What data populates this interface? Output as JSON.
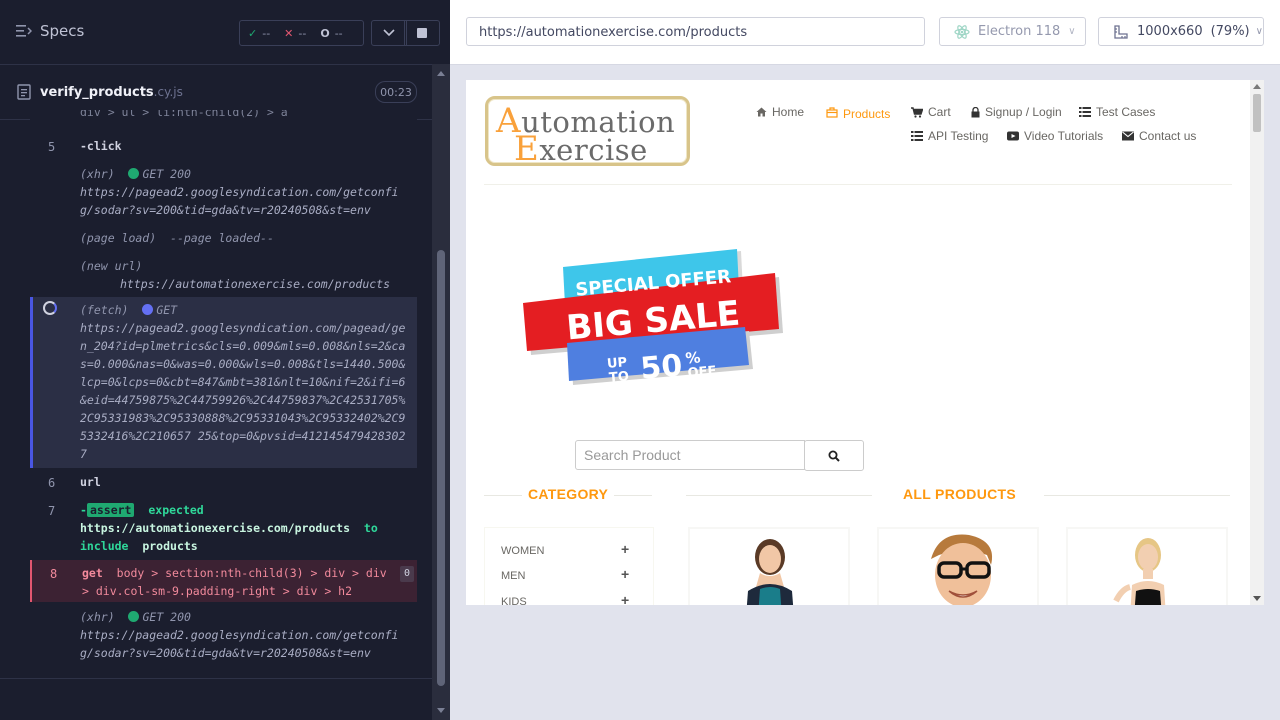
{
  "runner": {
    "specs_label": "Specs",
    "stats": {
      "passed": "--",
      "failed": "--",
      "pending": "--"
    },
    "spec_file": {
      "name": "verify_products",
      "ext": ".cy.js",
      "duration": "00:23"
    },
    "commands": [
      {
        "num": "",
        "name": "",
        "text": "div > ul > li:nth-child(2) > a"
      },
      {
        "num": "5",
        "name": "-click"
      },
      {
        "kind": "(xhr)",
        "method": "GET 200",
        "url": "https://pagead2.googlesyndication.com/getconfig/sodar?sv=200&tid=gda&tv=r20240508&st=env"
      },
      {
        "kind": "(page load)",
        "message": "--page loaded--"
      },
      {
        "kind": "(new url)",
        "url": "https://automationexercise.com/products"
      },
      {
        "kind": "(fetch)",
        "method": "GET",
        "url": "https://pagead2.googlesyndication.com/pagead/gen_204?id=plmetrics&cls=0.009&mls=0.008&nls=2&cas=0.000&nas=0&was=0.000&wls=0.008&tls=1440.500&lcp=0&lcps=0&cbt=847&mbt=381&nlt=10&nif=2&ifi=6&eid=44759875%2C44759926%2C44759837%2C42531705%2C95331983%2C95330888%2C95331043%2C95332402%2C95332416%2C210657 25&top=0&pvsid=4121454794283027"
      },
      {
        "num": "6",
        "name": "url"
      },
      {
        "num": "7",
        "name": "-assert",
        "expected": "expected",
        "value": "https://automationexercise.com/products",
        "to": "to",
        "include": "include",
        "target": "products"
      },
      {
        "num": "8",
        "name": "get",
        "selector": "body > section:nth-child(3) > div > div > div.col-sm-9.padding-right > div > h2",
        "count": "0"
      },
      {
        "kind": "(xhr)",
        "method": "GET 200",
        "url": "https://pagead2.googlesyndication.com/getconfig/sodar?sv=200&tid=gda&tv=r20240508&st=env"
      }
    ]
  },
  "toolbar": {
    "url": "https://automationexercise.com/products",
    "browser": "Electron 118",
    "viewport": "1000x660",
    "scale": "(79%)"
  },
  "aut": {
    "logo": {
      "line1_cap": "A",
      "line1_rest": "utomation",
      "line2_cap": "E",
      "line2_rest": "xercise"
    },
    "nav": [
      {
        "label": "Home",
        "icon": "home-icon"
      },
      {
        "label": "Products",
        "icon": "products-icon"
      },
      {
        "label": "Cart",
        "icon": "cart-icon"
      },
      {
        "label": "Signup / Login",
        "icon": "lock-icon"
      },
      {
        "label": "Test Cases",
        "icon": "list-icon"
      },
      {
        "label": "API Testing",
        "icon": "list-icon"
      },
      {
        "label": "Video Tutorials",
        "icon": "youtube-icon"
      },
      {
        "label": "Contact us",
        "icon": "envelope-icon"
      }
    ],
    "banner": {
      "line1": "SPECIAL OFFER",
      "line2": "BIG SALE",
      "up": "UP",
      "to": "TO",
      "pct": "50",
      "pct_sign": "%",
      "off": "OFF"
    },
    "search": {
      "placeholder": "Search Product"
    },
    "category_title": "CATEGORY",
    "all_products_title": "ALL PRODUCTS",
    "categories": [
      "WOMEN",
      "MEN",
      "KIDS"
    ],
    "colors": {
      "accent": "#fe980f",
      "cypress_bg": "#1b1e2e",
      "pass": "#1fa971",
      "fail": "#e45770"
    }
  }
}
